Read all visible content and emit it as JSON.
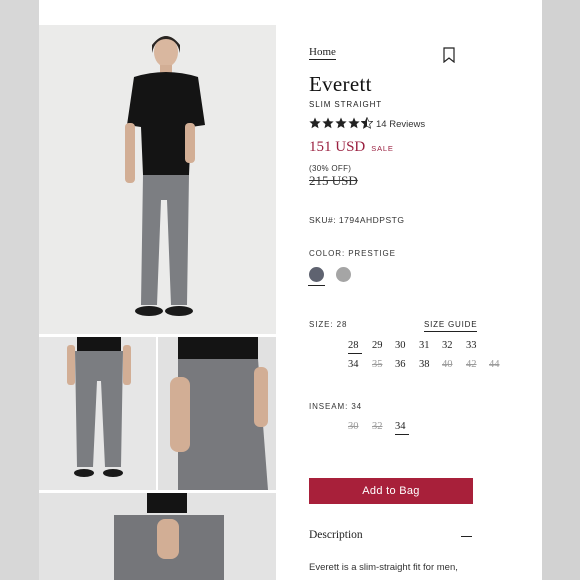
{
  "breadcrumb": {
    "home": "Home"
  },
  "product": {
    "title": "Everett",
    "subtitle": "SLIM STRAIGHT",
    "rating": 4.5,
    "rating_max": 5,
    "reviews": "14 Reviews",
    "price": "151 USD",
    "sale_tag": "SALE",
    "discount": "(30% OFF)",
    "original_price": "215 USD",
    "sku": "SKU#: 1794AHDPSTG"
  },
  "color": {
    "label": "COLOR: PRESTIGE",
    "swatches": [
      {
        "name": "Prestige",
        "hex": "#5f6370",
        "selected": true
      },
      {
        "name": "Grey",
        "hex": "#a5a5a5",
        "selected": false
      }
    ]
  },
  "size": {
    "label": "SIZE: 28",
    "guide": "SIZE GUIDE",
    "options": [
      {
        "label": "28",
        "available": true,
        "selected": true
      },
      {
        "label": "29",
        "available": true,
        "selected": false
      },
      {
        "label": "30",
        "available": true,
        "selected": false
      },
      {
        "label": "31",
        "available": true,
        "selected": false
      },
      {
        "label": "32",
        "available": true,
        "selected": false
      },
      {
        "label": "33",
        "available": true,
        "selected": false
      },
      {
        "label": "34",
        "available": true,
        "selected": false
      },
      {
        "label": "35",
        "available": false,
        "selected": false
      },
      {
        "label": "36",
        "available": true,
        "selected": false
      },
      {
        "label": "38",
        "available": true,
        "selected": false
      },
      {
        "label": "40",
        "available": false,
        "selected": false
      },
      {
        "label": "42",
        "available": false,
        "selected": false
      },
      {
        "label": "44",
        "available": false,
        "selected": false
      }
    ]
  },
  "inseam": {
    "label": "INSEAM: 34",
    "options": [
      {
        "label": "30",
        "available": false,
        "selected": false
      },
      {
        "label": "32",
        "available": false,
        "selected": false
      },
      {
        "label": "34",
        "available": true,
        "selected": true
      }
    ]
  },
  "cta": {
    "add_to_bag": "Add to Bag"
  },
  "description": {
    "title": "Description",
    "text": "Everett is a slim-straight fit for men,"
  },
  "colors": {
    "accent": "#a8203a",
    "price": "#9a2040"
  }
}
